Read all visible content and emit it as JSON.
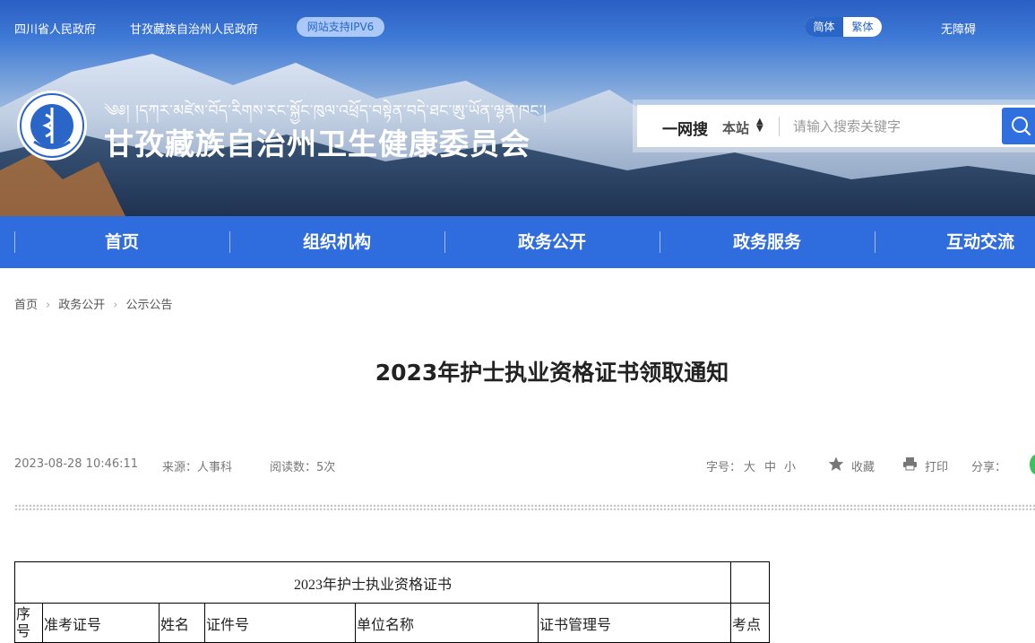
{
  "topbar": {
    "link1": "四川省人民政府",
    "link2": "甘孜藏族自治州人民政府",
    "ipv6": "网站支持IPV6",
    "lang_simplified": "简体",
    "lang_traditional": "繁体",
    "accessibility": "无障碍"
  },
  "site": {
    "tibetan_title": "༄༅། །དཀར་མཛེས་བོད་རིགས་རང་སྐྱོང་ཁུལ་འཕྲོད་བསྟེན་བདེ་ཐང་ཨུ་ཡོན་ལྷན་ཁང་།",
    "title": "甘孜藏族自治州卫生健康委员会"
  },
  "search": {
    "brand": "一网搜",
    "scope": "本站",
    "placeholder": "请输入搜索关键字"
  },
  "nav": {
    "items": [
      "首页",
      "组织机构",
      "政务公开",
      "政务服务",
      "互动交流"
    ]
  },
  "breadcrumb": [
    "首页",
    "政务公开",
    "公示公告"
  ],
  "article": {
    "title": "2023年护士执业资格证书领取通知",
    "date": "2023-08-28 10:46:11",
    "source": "来源：人事科",
    "reads": "阅读数：5次"
  },
  "tools": {
    "fontsize_label": "字号：",
    "large": "大",
    "medium": "中",
    "small": "小",
    "favorite": "收藏",
    "print": "打印",
    "share": "分享："
  },
  "table": {
    "caption": "2023年护士执业资格证书",
    "headers": [
      "序号",
      "准考证号",
      "姓名",
      "证件号",
      "单位名称",
      "证书管理号",
      "考点"
    ]
  },
  "colors": {
    "nav_blue": "#2f6ddf",
    "accent_blue": "#2a66c8"
  }
}
